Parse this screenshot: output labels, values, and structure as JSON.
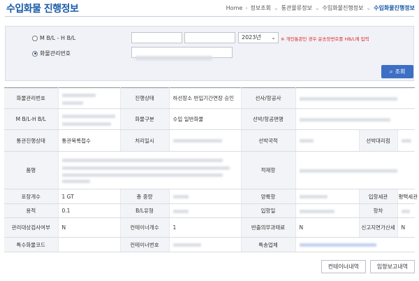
{
  "page": {
    "title": "수입화물 진행정보"
  },
  "breadcrumb": [
    {
      "label": "Home"
    },
    {
      "label": "정보조회"
    },
    {
      "label": "통관물류정보"
    },
    {
      "label": "수입화물진행정보"
    },
    {
      "label": "수입화물진행정보"
    }
  ],
  "search": {
    "option_mbl": "M B/L - H B/L",
    "option_cargo": "화물관리번호",
    "selected_option": "화물관리번호",
    "mbl_value": "",
    "hbl_value": "",
    "year": "2023년",
    "warning": "※ 개인통관인 경우 운송장번호를 HB/L에 입력",
    "button": "조회",
    "icon": "search-icon"
  },
  "table": {
    "r1": {
      "l1": "화물관리번호",
      "l2": "진행상태",
      "v2": "하선장소 반입기간연장 승인",
      "l3": "선사/항공사"
    },
    "r2": {
      "l1": "M B/L-H B/L",
      "l2": "화물구분",
      "v2": "수입 일반화물",
      "l3": "선박/항공편명"
    },
    "r3": {
      "l1": "통관진행상태",
      "v1": "통관목록접수",
      "l2": "처리일시",
      "l3": "선박국적",
      "l4": "선박대리점"
    },
    "r4": {
      "l1": "품명",
      "l2": "적재항"
    },
    "r5": {
      "l1": "포장개수",
      "v1": "1 GT",
      "l2": "총 중량",
      "l3": "양륙항",
      "l4": "입항세관",
      "v4": "평택세관"
    },
    "r6": {
      "l1": "용적",
      "v1": "0.1",
      "l2": "B/L유형",
      "l3": "입항일",
      "l4": "항차"
    },
    "r7": {
      "l1": "관리대상검사여부",
      "v1": "N",
      "l2": "컨테이너개수",
      "v2": "1",
      "l3": "반출의무과태료",
      "v3": "N",
      "l4": "신고지연가산세",
      "v4": "N"
    },
    "r8": {
      "l1": "특수화물코드",
      "l2": "컨테이너번호",
      "l3": "특송업체"
    }
  },
  "actions": {
    "container": "컨테이너내역",
    "entry_report": "입항보고내역"
  }
}
